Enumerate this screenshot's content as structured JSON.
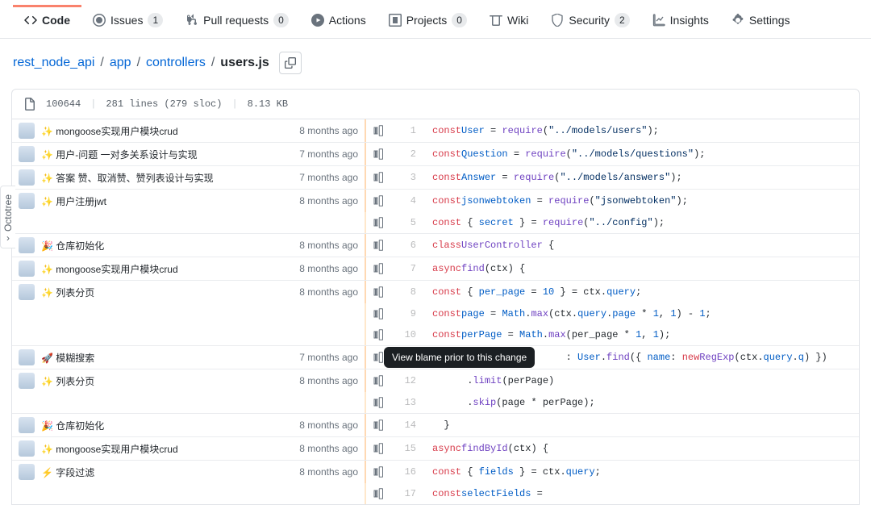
{
  "tabs": [
    {
      "label": "Code",
      "active": true
    },
    {
      "label": "Issues",
      "count": "1"
    },
    {
      "label": "Pull requests",
      "count": "0"
    },
    {
      "label": "Actions"
    },
    {
      "label": "Projects",
      "count": "0"
    },
    {
      "label": "Wiki"
    },
    {
      "label": "Security",
      "count": "2"
    },
    {
      "label": "Insights"
    },
    {
      "label": "Settings"
    }
  ],
  "breadcrumb": {
    "root": "rest_node_api",
    "parts": [
      "app",
      "controllers"
    ],
    "file": "users.js"
  },
  "file_info": {
    "mode": "100644",
    "lines": "281 lines (279 sloc)",
    "size": "8.13 KB"
  },
  "tooltip": "View blame prior to this change",
  "octotree": "Octotree",
  "commits": [
    {
      "msg": "✨ mongoose实现用户模块crud",
      "time": "8 months ago"
    },
    {
      "msg": "✨ 用户-问题 一对多关系设计与实现",
      "time": "7 months ago"
    },
    {
      "msg": "✨ 答案 赞、取消赞、赞列表设计与实现",
      "time": "7 months ago"
    },
    {
      "msg": "✨ 用户注册jwt",
      "time": "8 months ago"
    },
    {
      "msg": "🎉 仓库初始化",
      "time": "8 months ago"
    },
    {
      "msg": "✨ mongoose实现用户模块crud",
      "time": "8 months ago"
    },
    {
      "msg": "✨ 列表分页",
      "time": "8 months ago"
    },
    {
      "msg": "🚀 模糊搜索",
      "time": "7 months ago"
    },
    {
      "msg": "✨ 列表分页",
      "time": "8 months ago"
    },
    {
      "msg": "🎉 仓库初始化",
      "time": "8 months ago"
    },
    {
      "msg": "✨ mongoose实现用户模块crud",
      "time": "8 months ago"
    },
    {
      "msg": "⚡ 字段过滤",
      "time": "8 months ago"
    }
  ],
  "lines": [
    {
      "n": "1",
      "commit": 0,
      "html": "<span class='k'>const</span> <span class='n'>User</span> = <span class='f'>require</span>(<span class='s'>\"../models/users\"</span>);"
    },
    {
      "n": "2",
      "commit": 1,
      "html": "<span class='k'>const</span> <span class='n'>Question</span> = <span class='f'>require</span>(<span class='s'>\"../models/questions\"</span>);"
    },
    {
      "n": "3",
      "commit": 2,
      "html": "<span class='k'>const</span> <span class='n'>Answer</span> = <span class='f'>require</span>(<span class='s'>\"../models/answers\"</span>);"
    },
    {
      "n": "4",
      "commit": 3,
      "html": "<span class='k'>const</span> <span class='n'>jsonwebtoken</span> = <span class='f'>require</span>(<span class='s'>\"jsonwebtoken\"</span>);"
    },
    {
      "n": "5",
      "html": "<span class='k'>const</span> { <span class='n'>secret</span> } = <span class='f'>require</span>(<span class='s'>\"../config\"</span>);"
    },
    {
      "n": "6",
      "commit": 4,
      "html": "<span class='k'>class</span> <span class='f'>UserController</span> {"
    },
    {
      "n": "7",
      "commit": 5,
      "html": "  <span class='k'>async</span> <span class='f'>find</span>(<span class='c'>ctx</span>) {"
    },
    {
      "n": "8",
      "commit": 6,
      "html": "    <span class='k'>const</span> { <span class='n'>per_page</span> = <span class='n'>10</span> } = ctx.<span class='n'>query</span>;"
    },
    {
      "n": "9",
      "html": "    <span class='k'>const</span> <span class='n'>page</span> = <span class='n'>Math</span>.<span class='f'>max</span>(ctx.<span class='n'>query</span>.<span class='n'>page</span> * <span class='n'>1</span>, <span class='n'>1</span>) - <span class='n'>1</span>;"
    },
    {
      "n": "10",
      "html": "    <span class='k'>const</span> <span class='n'>perPage</span> = <span class='n'>Math</span>.<span class='f'>max</span>(per_page * <span class='n'>1</span>, <span class='n'>1</span>);"
    },
    {
      "n": "11",
      "commit": 7,
      "tooltip": true,
      "html": "                       : <span class='n'>User</span>.<span class='f'>find</span>({ <span class='n'>name</span>: <span class='k'>new</span> <span class='f'>RegExp</span>(ctx.<span class='n'>query</span>.<span class='n'>q</span>) })"
    },
    {
      "n": "12",
      "commit": 8,
      "html": "      .<span class='f'>limit</span>(perPage)"
    },
    {
      "n": "13",
      "html": "      .<span class='f'>skip</span>(page * perPage);"
    },
    {
      "n": "14",
      "commit": 9,
      "html": "  }"
    },
    {
      "n": "15",
      "commit": 10,
      "html": "  <span class='k'>async</span> <span class='f'>findById</span>(<span class='c'>ctx</span>) {"
    },
    {
      "n": "16",
      "commit": 11,
      "html": "    <span class='k'>const</span> { <span class='n'>fields</span> } = ctx.<span class='n'>query</span>;"
    },
    {
      "n": "17",
      "html": "    <span class='k'>const</span> <span class='n'>selectFields</span> ="
    }
  ]
}
